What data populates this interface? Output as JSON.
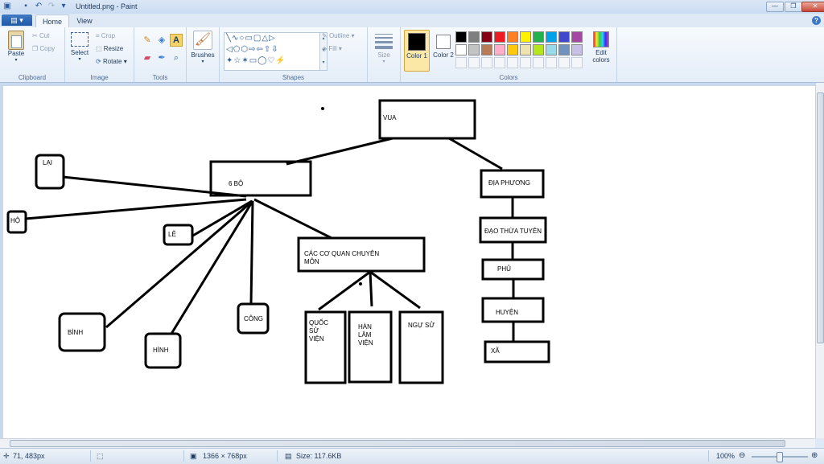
{
  "window": {
    "title": "Untitled.png - Paint",
    "minimize_glyph": "—",
    "maximize_glyph": "❐",
    "close_glyph": "✕"
  },
  "quick_access": [
    "paint-app-icon",
    "save-icon",
    "undo-icon",
    "redo-icon",
    "customize-icon"
  ],
  "tabs": {
    "file_glyph": "▤ ▾",
    "home": "Home",
    "view": "View"
  },
  "ribbon": {
    "clipboard": {
      "label": "Clipboard",
      "paste": "Paste",
      "cut": "Cut",
      "copy": "Copy"
    },
    "image": {
      "label": "Image",
      "select": "Select",
      "crop": "Crop",
      "resize": "Resize",
      "rotate": "Rotate"
    },
    "tools": {
      "label": "Tools"
    },
    "brushes": {
      "label": "Brushes"
    },
    "shapes": {
      "label": "Shapes",
      "outline": "Outline",
      "fill": "Fill"
    },
    "size": {
      "label": "Size"
    },
    "colors": {
      "label": "Colors",
      "color1": "Color 1",
      "color2": "Color 2",
      "edit_colors": "Edit colors",
      "color1_value": "#000000",
      "color2_value": "#ffffff",
      "palette_row1": [
        "#000000",
        "#7f7f7f",
        "#880015",
        "#ed1c24",
        "#ff7f27",
        "#fff200",
        "#22b14c",
        "#00a2e8",
        "#3f48cc",
        "#a349a4"
      ],
      "palette_row2": [
        "#ffffff",
        "#c3c3c3",
        "#b97a57",
        "#ffaec9",
        "#ffc90e",
        "#efe4b0",
        "#b5e61d",
        "#99d9ea",
        "#7092be",
        "#c8bfe7"
      ]
    }
  },
  "diagram": {
    "vua": "VUA",
    "sau_bo": "6 BỘ",
    "lai": "LẠI",
    "ho": "HỘ",
    "le": "LỄ",
    "binh": "BÌNH",
    "hinh": "HÌNH",
    "cong": "CÔNG",
    "co_quan": [
      "CÁC CƠ QUAN CHUYÊN",
      "MÔN"
    ],
    "quoc_su_vien": [
      "QUỐC",
      "SỬ",
      "VIỆN"
    ],
    "han_lam_vien": [
      "HÀN",
      "LÂM",
      "VIỆN"
    ],
    "ngu_su": "NGỰ SỬ",
    "dia_phuong": "ĐỊA PHƯƠNG",
    "dao_thua_tuyen": "ĐẠO THỪA TUYÊN",
    "phu": "PHỦ",
    "huyen": "HUYỆN",
    "xa": "XÃ"
  },
  "status": {
    "cursor": "71, 483px",
    "dimensions": "1366 × 768px",
    "size": "Size: 117.6KB",
    "zoom": "100%"
  }
}
